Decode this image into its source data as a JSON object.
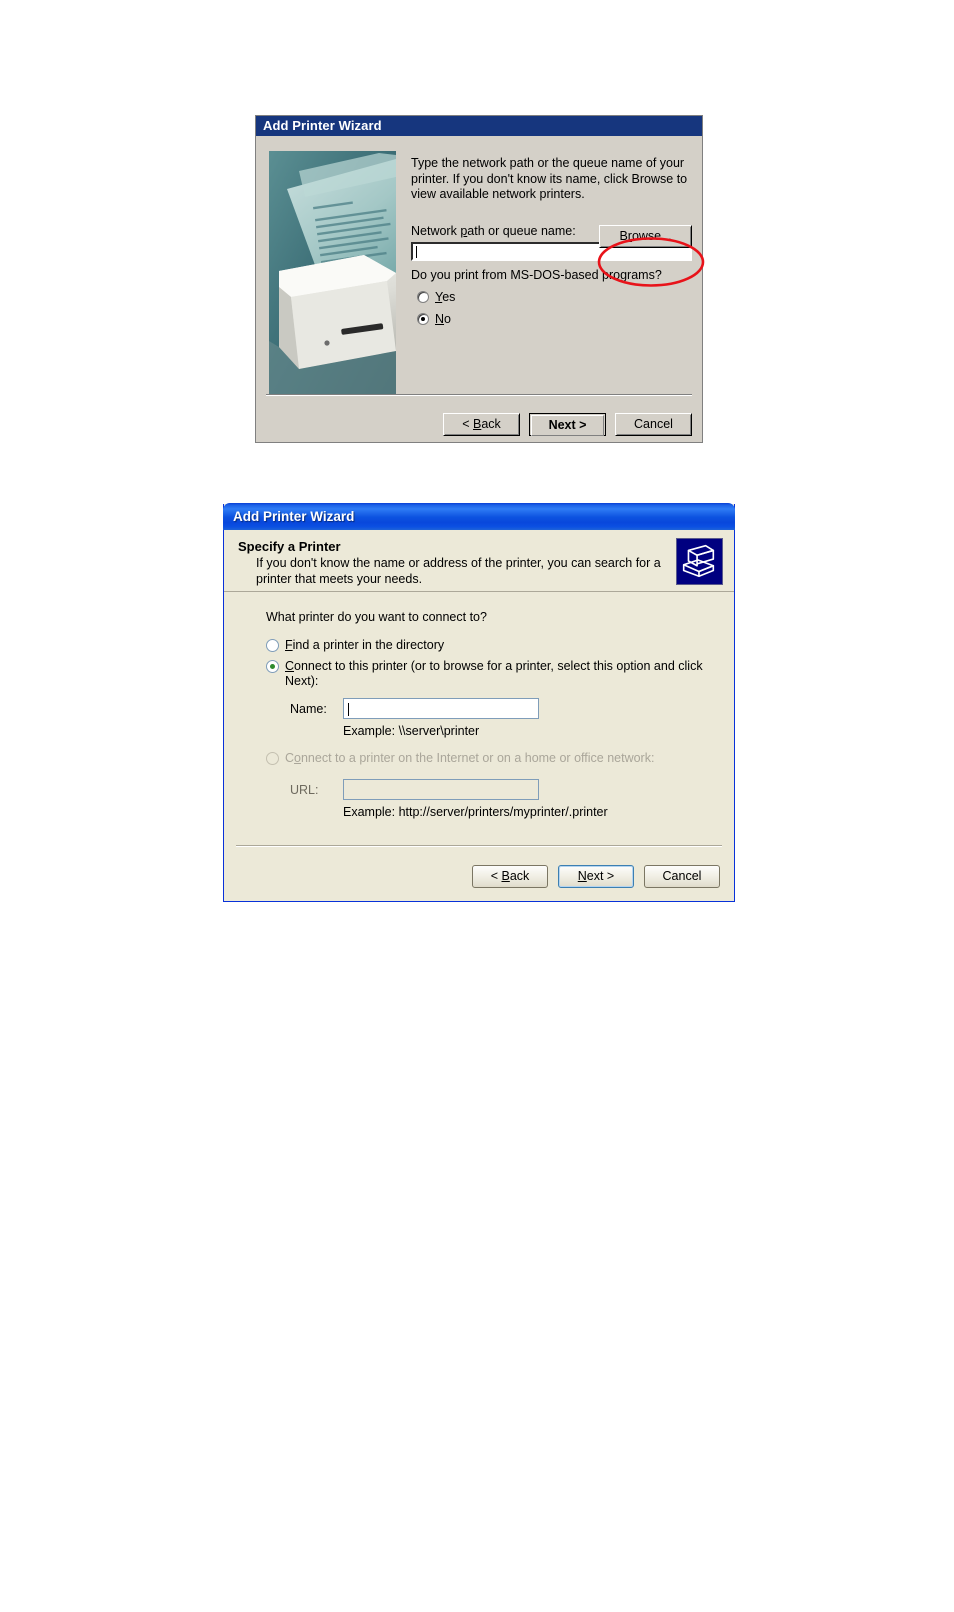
{
  "dialog_classic": {
    "title": "Add Printer Wizard",
    "illustration_icon": "printer-photo-illustration",
    "instruction": "Type the network path or the queue name of your printer. If you don't know its name, click Browse to view available network printers.",
    "path_label_pre": "Network ",
    "path_label_accel": "p",
    "path_label_post": "ath or queue name:",
    "path_value": "",
    "browse_pre": "B",
    "browse_accel": "r",
    "browse_post": "owse...",
    "dos_question": "Do you print from MS-DOS-based programs?",
    "radios": [
      {
        "label_pre": "",
        "accel": "Y",
        "label_post": "es",
        "checked": false
      },
      {
        "label_pre": "",
        "accel": "N",
        "label_post": "o",
        "checked": true
      }
    ],
    "buttons": {
      "back_pre": "< ",
      "back_accel": "B",
      "back_post": "ack",
      "next": "Next >",
      "cancel": "Cancel"
    },
    "annotation": {
      "shape": "red-ellipse-highlight",
      "color": "#e8131a",
      "target": "browse-button"
    }
  },
  "dialog_xp": {
    "title": "Add Printer Wizard",
    "header_title": "Specify a Printer",
    "header_subtitle": "If you don't know the name or address of the printer, you can search for a printer that meets your needs.",
    "header_icon": "printer-icon",
    "question": "What printer do you want to connect to?",
    "options": [
      {
        "accel": "F",
        "label_pre": "",
        "label_post": "ind a printer in the directory",
        "checked": false,
        "disabled": false
      },
      {
        "accel": "C",
        "label_pre": "",
        "label_post": "onnect to this printer (or to browse for a printer, select this option and click Next):",
        "checked": true,
        "disabled": false
      },
      {
        "accel": "o",
        "label_pre": "C",
        "label_post": "nnect to a printer on the Internet or on a home or office network:",
        "checked": false,
        "disabled": true
      }
    ],
    "name_field": {
      "label": "Name:",
      "value": "",
      "example": "Example: \\\\server\\printer"
    },
    "url_field": {
      "label": "URL:",
      "value": "",
      "example": "Example: http://server/printers/myprinter/.printer",
      "disabled": true
    },
    "buttons": {
      "back_pre": "< ",
      "back_accel": "B",
      "back_post": "ack",
      "next_pre": "",
      "next_accel": "N",
      "next_post": "ext >",
      "cancel": "Cancel"
    }
  },
  "colors": {
    "classic_titlebar": "#16367e",
    "classic_face": "#d4d0c8",
    "xp_titlebar": "#0a3fd4",
    "xp_face": "#ece9d8",
    "annotation_red": "#e8131a",
    "xp_radio_dot": "#2d8a2d"
  }
}
